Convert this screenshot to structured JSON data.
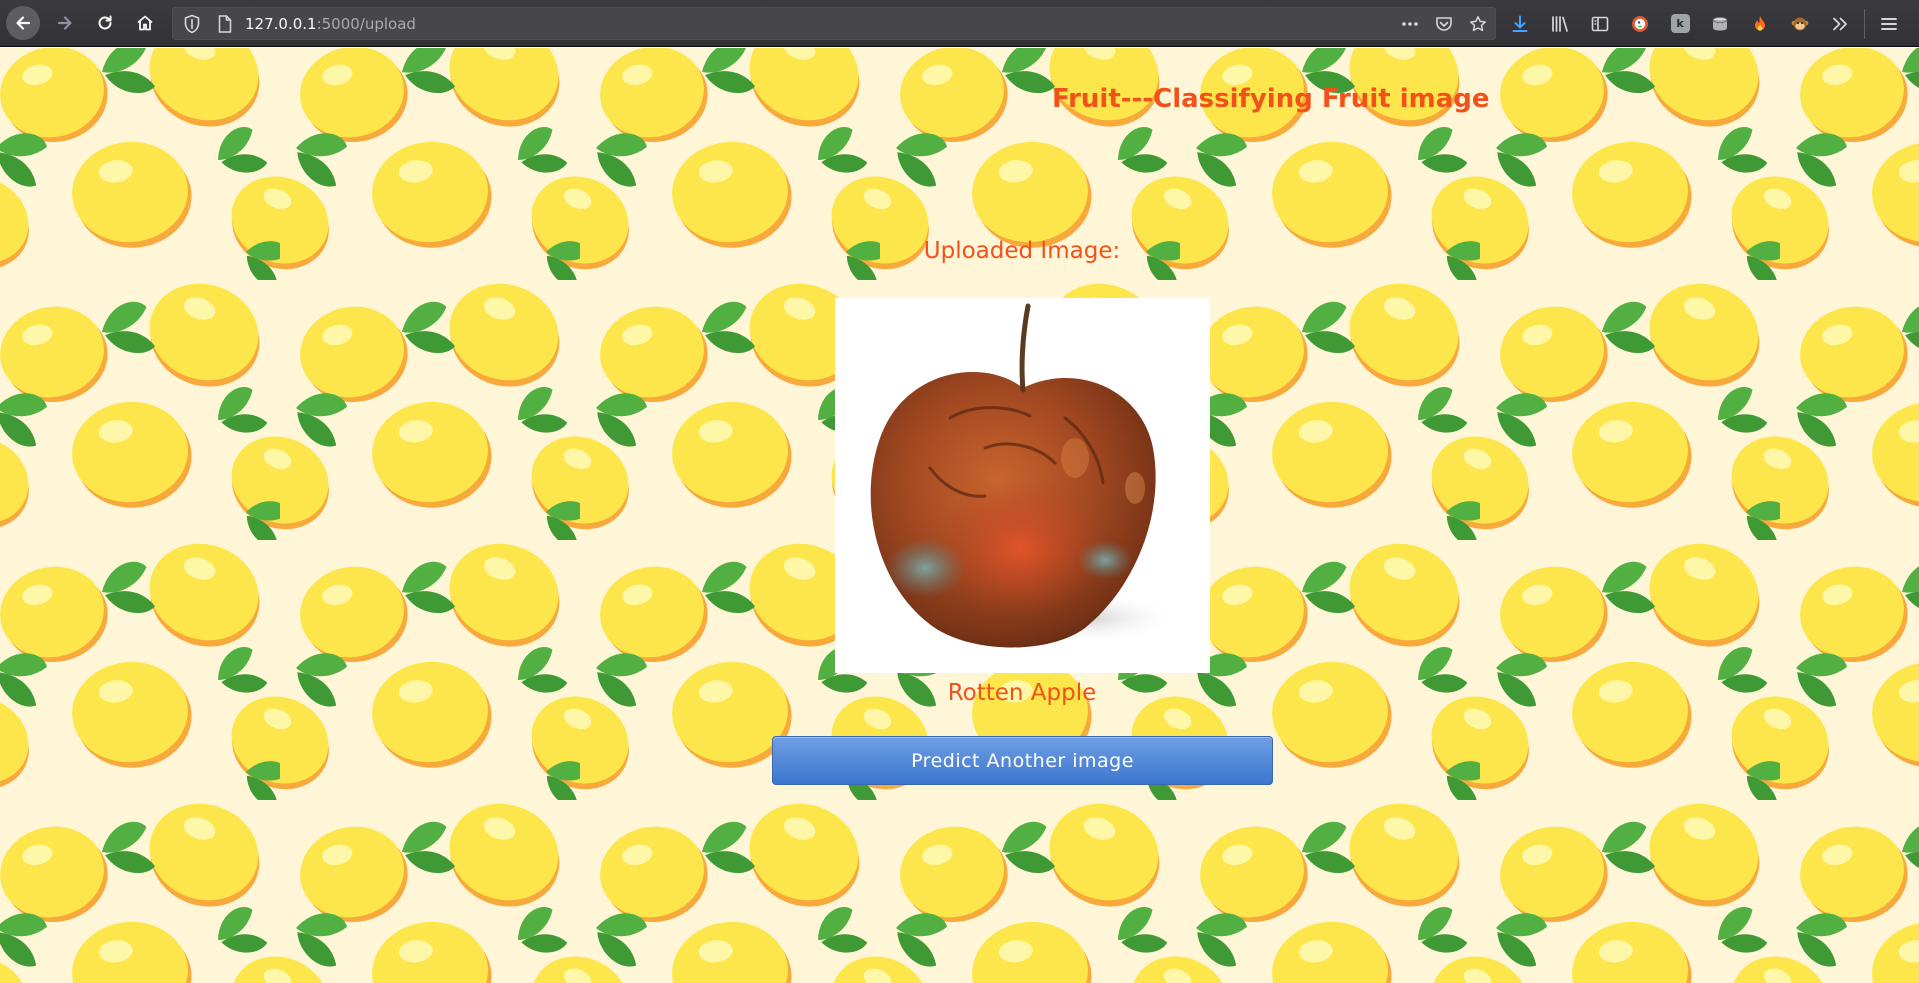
{
  "browser": {
    "url_host": "127.0.0.1",
    "url_path": ":5000/upload",
    "icons": {
      "back": "arrow-left-icon",
      "forward": "arrow-right-icon",
      "reload": "reload-icon",
      "home": "home-icon",
      "shield": "tracking-shield-icon",
      "page": "page-info-icon",
      "more": "more-actions-icon",
      "pocket": "pocket-icon",
      "bookmark": "star-icon",
      "download": "download-icon",
      "library": "library-icon",
      "sidebar": "sidebar-icon",
      "menu": "hamburger-menu-icon"
    },
    "extensions": [
      "duckduckgo-icon",
      "extension-k-icon",
      "extension-cylinder-icon",
      "extension-fire-icon",
      "extension-monkey-icon"
    ]
  },
  "page": {
    "title": "Fruit---Classifying Fruit image",
    "uploaded_label": "Uploaded Image:",
    "image_alt": "rotten apple photo",
    "result": "Rotten Apple",
    "predict_button": "Predict Another image"
  },
  "colors": {
    "accent_text": "#f0521a",
    "page_background": "#fff6d8",
    "button_top": "#6f9fe3",
    "button_bottom": "#3d76cf",
    "lemon": "#fde64b",
    "lemon_shadow": "#f7a93b",
    "leaf": "#52b043"
  }
}
